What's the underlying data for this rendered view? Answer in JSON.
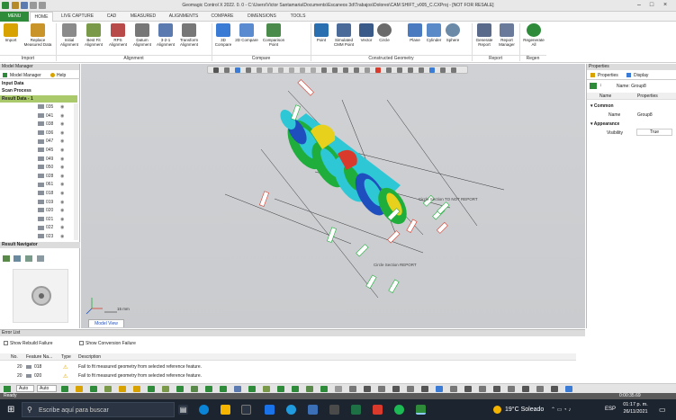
{
  "app": {
    "title": "Geomagic Control X 2022. 0. 0 - C:\\Users\\Victor Santamaria\\Documents\\Escaneos 3d\\Trabajos\\Dolores\\CAM SHIFT_v005_C.CXProj - [NOT FOR RESALE]"
  },
  "tabs": [
    "MENU",
    "HOME",
    "LIVE CAPTURE",
    "CAD",
    "MEASURED",
    "ALIGNMENTS",
    "COMPARE",
    "DIMENSIONS",
    "TOOLS"
  ],
  "ribbon": {
    "buttons": [
      {
        "label": "Import",
        "color": "#d8a200"
      },
      {
        "label": "Replace Measured Data",
        "color": "#c9952a"
      },
      {
        "label": "Initial Alignment",
        "color": "#8a8a8a"
      },
      {
        "label": "Best Fit Alignment",
        "color": "#7a9a4a"
      },
      {
        "label": "RPS Alignment",
        "color": "#b84a4a"
      },
      {
        "label": "Datum Alignment",
        "color": "#777777"
      },
      {
        "label": "3-2-1 Alignment",
        "color": "#5a7ab0"
      },
      {
        "label": "Transform Alignment",
        "color": "#777777"
      },
      {
        "label": "3D Compare",
        "color": "#3a7bd5"
      },
      {
        "label": "2D Compare",
        "color": "#5a8ad0"
      },
      {
        "label": "Comparison Point",
        "color": "#4a8a4a"
      },
      {
        "label": "Point",
        "color": "#2a6fb0"
      },
      {
        "label": "Simulated CMM Point",
        "color": "#4a6a9a"
      },
      {
        "label": "Vector",
        "color": "#3a5a8a"
      },
      {
        "label": "Circle",
        "color": "#6a6a6a"
      },
      {
        "label": "Plane",
        "color": "#4a7ac0"
      },
      {
        "label": "Cylinder",
        "color": "#5a8ac8"
      },
      {
        "label": "Sphere",
        "color": "#6a8aa8"
      },
      {
        "label": "Generate Report",
        "color": "#5a6a8a"
      },
      {
        "label": "Report Manager",
        "color": "#6a7a9a"
      },
      {
        "label": "Regenerate All",
        "color": "#2e8b3a"
      }
    ],
    "groups": [
      "Import",
      "Alignment",
      "Compare",
      "Constructed Geometry",
      "Report",
      "Regen"
    ]
  },
  "model_manager": {
    "title": "Model Manager",
    "tab_model": "Model Manager",
    "tab_help": "Help",
    "sections": [
      "Input Data",
      "Scan Process",
      "Result Data - 1"
    ],
    "items": [
      "035",
      "041",
      "038",
      "036",
      "047",
      "045",
      "049",
      "050",
      "028",
      "061",
      "018",
      "019",
      "020",
      "021",
      "022",
      "023"
    ]
  },
  "result_navigator": {
    "title": "Result Navigator"
  },
  "viewport": {
    "tab": "Model View",
    "scale_label": "15 mm",
    "annotation_1": "Circle Section TO NOT REPORT",
    "annotation_2": "Circle Section REPORT",
    "colors": {
      "green": "#1fae3b",
      "cyan": "#2ec7d6",
      "blue": "#1f4fbf",
      "yellow": "#e8d11c",
      "red": "#d93a2b"
    }
  },
  "properties": {
    "title": "Properties",
    "tab_properties": "Properties",
    "tab_display": "Display",
    "name_field": "Name: Group8",
    "col_name": "Name",
    "col_props": "Properties",
    "common": "Common",
    "name_label": "Name",
    "name_value": "Group8",
    "appearance": "Appearance",
    "visibility_label": "Visibility",
    "visibility_value": "True"
  },
  "error_list": {
    "title": "Error List",
    "show_rebuild": "Show Rebuild Failure",
    "show_conversion": "Show Conversion Failure",
    "headers": [
      "No.",
      "Feature Na...",
      "Type",
      "Description"
    ],
    "rows": [
      {
        "no": "20",
        "feature": "018",
        "description": "Fail to fit measured geometry from selected reference feature."
      },
      {
        "no": "20",
        "feature": "020",
        "description": "Fail to fit measured geometry from selected reference feature."
      }
    ]
  },
  "bottom": {
    "auto1": "Auto",
    "auto2": "Auto"
  },
  "status": {
    "text": "Ready",
    "time": "0:00:35.69"
  },
  "taskbar": {
    "search": "Escribe aquí para buscar",
    "weather": "19°C Soleado",
    "lang": "ESP",
    "clock_time": "01:17 p. m.",
    "clock_date": "26/11/2021"
  }
}
